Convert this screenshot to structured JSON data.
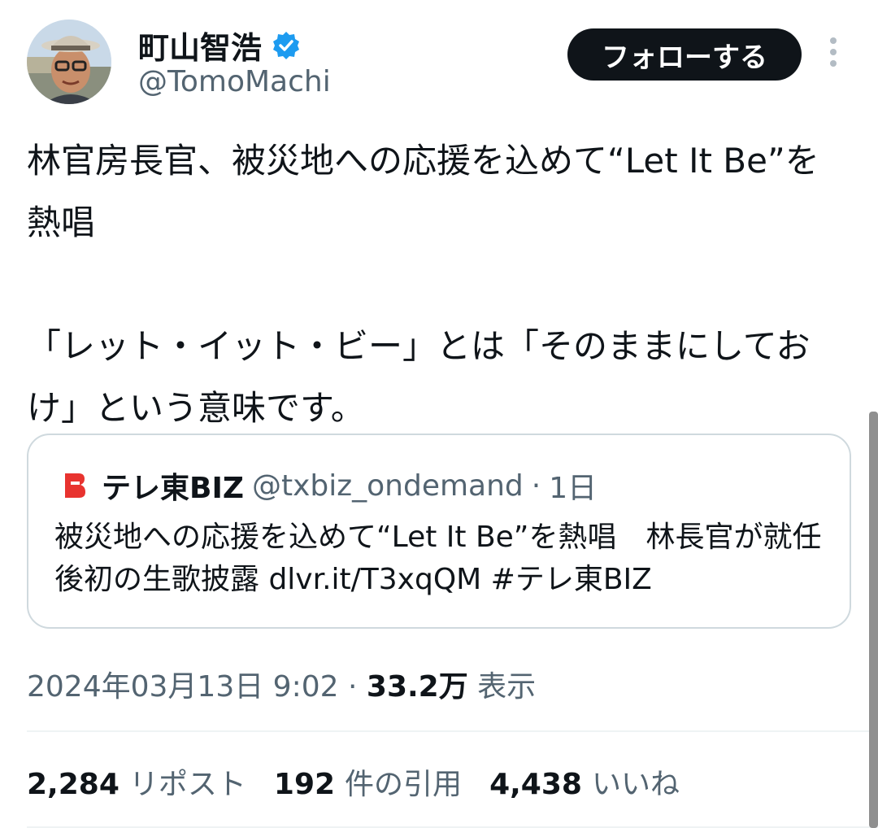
{
  "author": {
    "name": "町山智浩",
    "handle": "@TomoMachi",
    "verified_color": "#1d9bf0"
  },
  "follow_button": {
    "label": "フォローする"
  },
  "tweet": {
    "text": "林官房長官、被災地への応援を込めて“Let It Be”を熱唱\n\n「レット・イット・ビー」とは「そのままにしておけ」という意味です。"
  },
  "quote": {
    "logo_color": "#e8332f",
    "name": "テレ東BIZ",
    "handle": "@txbiz_ondemand",
    "separator": "·",
    "time": "1日",
    "text": "被災地への応援を込めて“Let It Be”を熱唱　林長官が就任後初の生歌披露 dlvr.it/T3xqQM #テレ東BIZ"
  },
  "meta": {
    "datetime": "2024年03月13日 9:02",
    "separator": "·",
    "views_count": "33.2万",
    "views_label": "表示"
  },
  "stats": [
    {
      "count": "2,284",
      "label": "リポスト"
    },
    {
      "count": "192",
      "label": "件の引用"
    },
    {
      "count": "4,438",
      "label": "いいね"
    }
  ]
}
